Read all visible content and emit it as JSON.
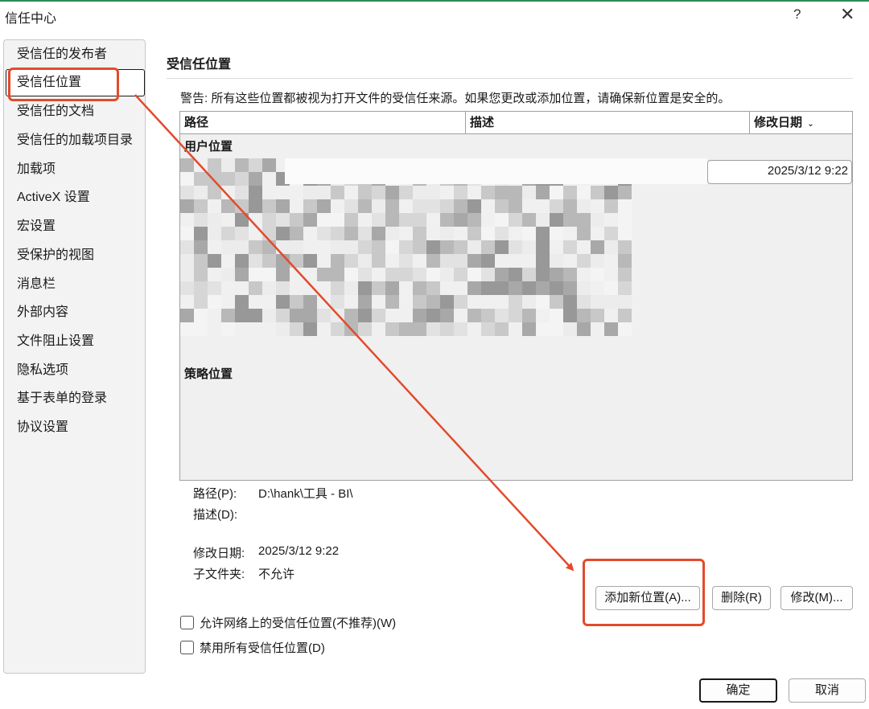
{
  "window": {
    "title": "信任中心",
    "help": "?",
    "close": "✕"
  },
  "sidebar": {
    "items": [
      {
        "label": "受信任的发布者"
      },
      {
        "label": "受信任位置",
        "selected": true
      },
      {
        "label": "受信任的文档"
      },
      {
        "label": "受信任的加载项目录"
      },
      {
        "label": "加载项"
      },
      {
        "label": "ActiveX 设置"
      },
      {
        "label": "宏设置"
      },
      {
        "label": "受保护的视图"
      },
      {
        "label": "消息栏"
      },
      {
        "label": "外部内容"
      },
      {
        "label": "文件阻止设置"
      },
      {
        "label": "隐私选项"
      },
      {
        "label": "基于表单的登录"
      },
      {
        "label": "协议设置"
      }
    ]
  },
  "main": {
    "title": "受信任位置",
    "warning": "警告: 所有这些位置都被视为打开文件的受信任来源。如果您更改或添加位置，请确保新位置是安全的。",
    "table": {
      "headers": [
        "路径",
        "描述",
        "修改日期"
      ],
      "sort_icon": "chevron-down-icon",
      "user_group": "用户位置",
      "policy_group": "策略位置",
      "selected_date": "2025/3/12 9:22"
    },
    "details": {
      "path_label": "路径(P):",
      "path_value": "D:\\hank\\工具 - BI\\",
      "desc_label": "描述(D):",
      "date_label": "修改日期:",
      "date_value": "2025/3/12 9:22",
      "sub_label": "子文件夹:",
      "sub_value": "不允许"
    },
    "buttons": {
      "add": "添加新位置(A)...",
      "delete": "删除(R)",
      "modify": "修改(M)..."
    },
    "checkboxes": {
      "network": "允许网络上的受信任位置(不推荐)(W)",
      "disable_all": "禁用所有受信任位置(D)"
    }
  },
  "footer": {
    "ok": "确定",
    "cancel": "取消"
  },
  "colors": {
    "annotation": "#e24b2c",
    "accent": "#2e8b57"
  }
}
